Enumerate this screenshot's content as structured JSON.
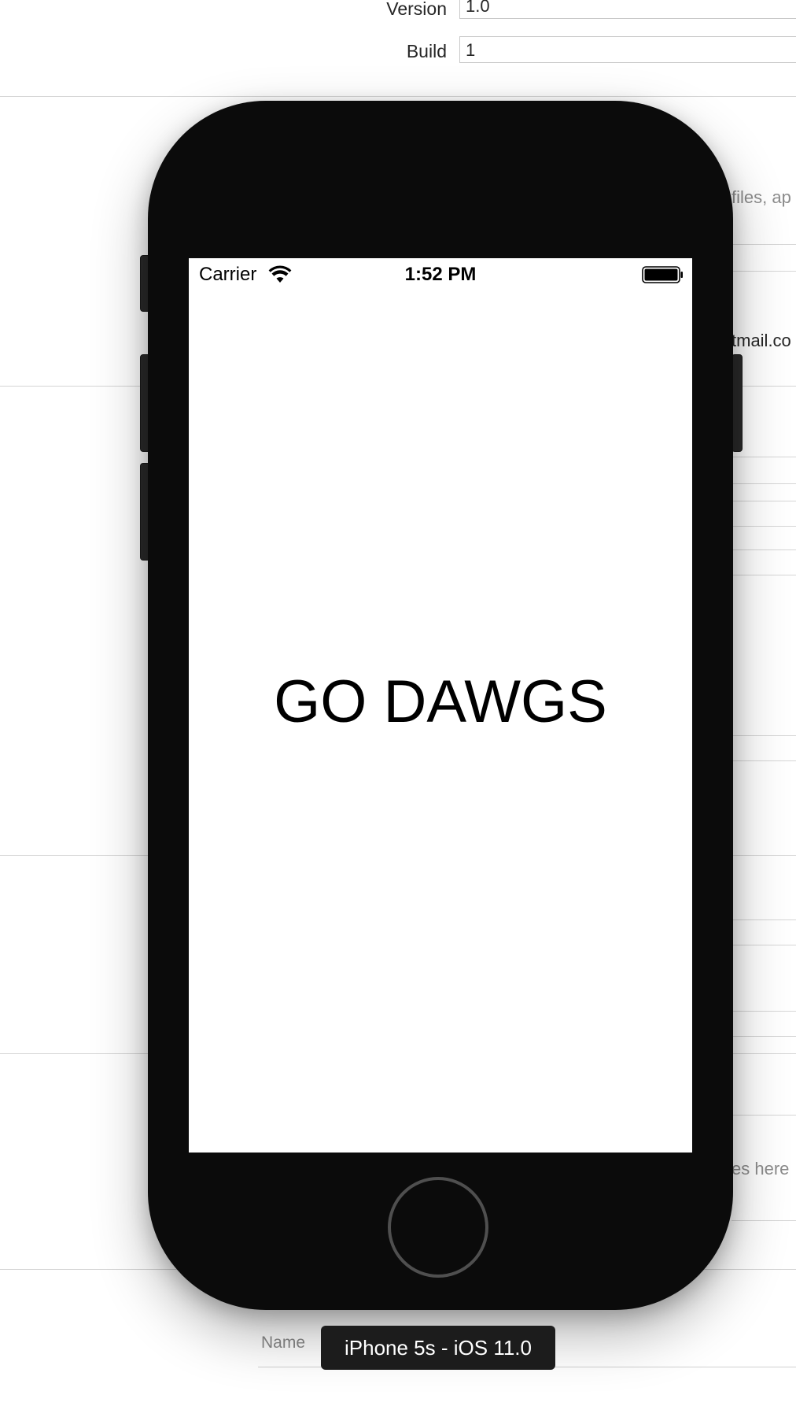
{
  "xcode": {
    "version_label": "Version",
    "version_value": "1.0",
    "build_label": "Build",
    "build_value": "1",
    "peek_profiles": "files, ap",
    "peek_email": "tmail.co",
    "peek_here": "es here",
    "name_label": "Name"
  },
  "simulator": {
    "device_label": "iPhone 5s - iOS 11.0",
    "status_bar": {
      "carrier": "Carrier",
      "time": "1:52 PM"
    },
    "screen_text": "GO DAWGS"
  }
}
